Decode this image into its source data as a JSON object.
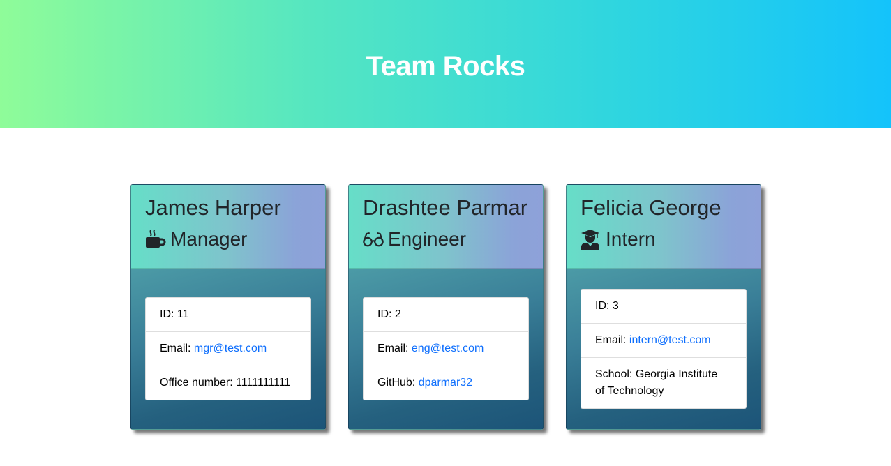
{
  "header": {
    "title": "Team Rocks"
  },
  "manager": {
    "name": "James Harper",
    "role": "Manager",
    "role_icon": "coffee-cup-icon",
    "id": "11",
    "email": "mgr@test.com",
    "extra_label": "Office number:",
    "extra_value": "1111111111"
  },
  "engineer": {
    "name": "Drashtee Parmar",
    "role": "Engineer",
    "role_icon": "glasses-icon",
    "id": "2",
    "email": "eng@test.com",
    "extra_label": "GitHub:",
    "extra_value": "dparmar32"
  },
  "intern": {
    "name": "Felicia George",
    "role": "Intern",
    "role_icon": "graduate-icon",
    "id": "3",
    "email": "intern@test.com",
    "extra_label": "School:",
    "extra_value": "Georgia Institute of Technology"
  },
  "labels": {
    "id": "ID:",
    "email": "Email:"
  },
  "colors": {
    "header_gradient": [
      "#8ffc99",
      "#14c3fb"
    ],
    "card_head_gradient": [
      "#66dec8",
      "#8ea1d9"
    ],
    "card_body_gradient": [
      "#6cc7bb",
      "#1c5478"
    ],
    "link": "#0d6efd"
  }
}
